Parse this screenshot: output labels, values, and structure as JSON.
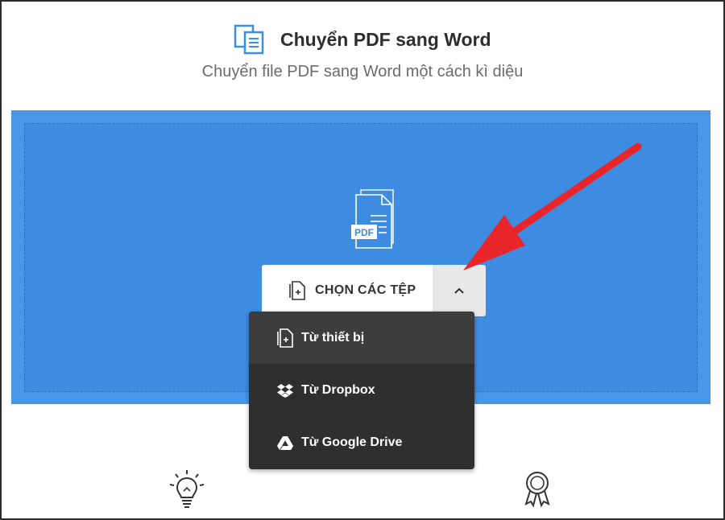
{
  "header": {
    "title": "Chuyển PDF sang Word",
    "subtitle": "Chuyển file PDF sang Word một cách kì diệu",
    "icon": "document-pair-icon"
  },
  "dropzone": {
    "graphic_label": "PDF",
    "choose_button_label": "CHỌN CÁC TỆP"
  },
  "menu": {
    "items": [
      {
        "label": "Từ thiết bị",
        "icon": "device-file-icon"
      },
      {
        "label": "Từ Dropbox",
        "icon": "dropbox-icon"
      },
      {
        "label": "Từ Google Drive",
        "icon": "google-drive-icon"
      }
    ]
  },
  "colors": {
    "accent": "#4796ea",
    "menu_bg": "#2f2f2f",
    "arrow": "#e8262a"
  }
}
